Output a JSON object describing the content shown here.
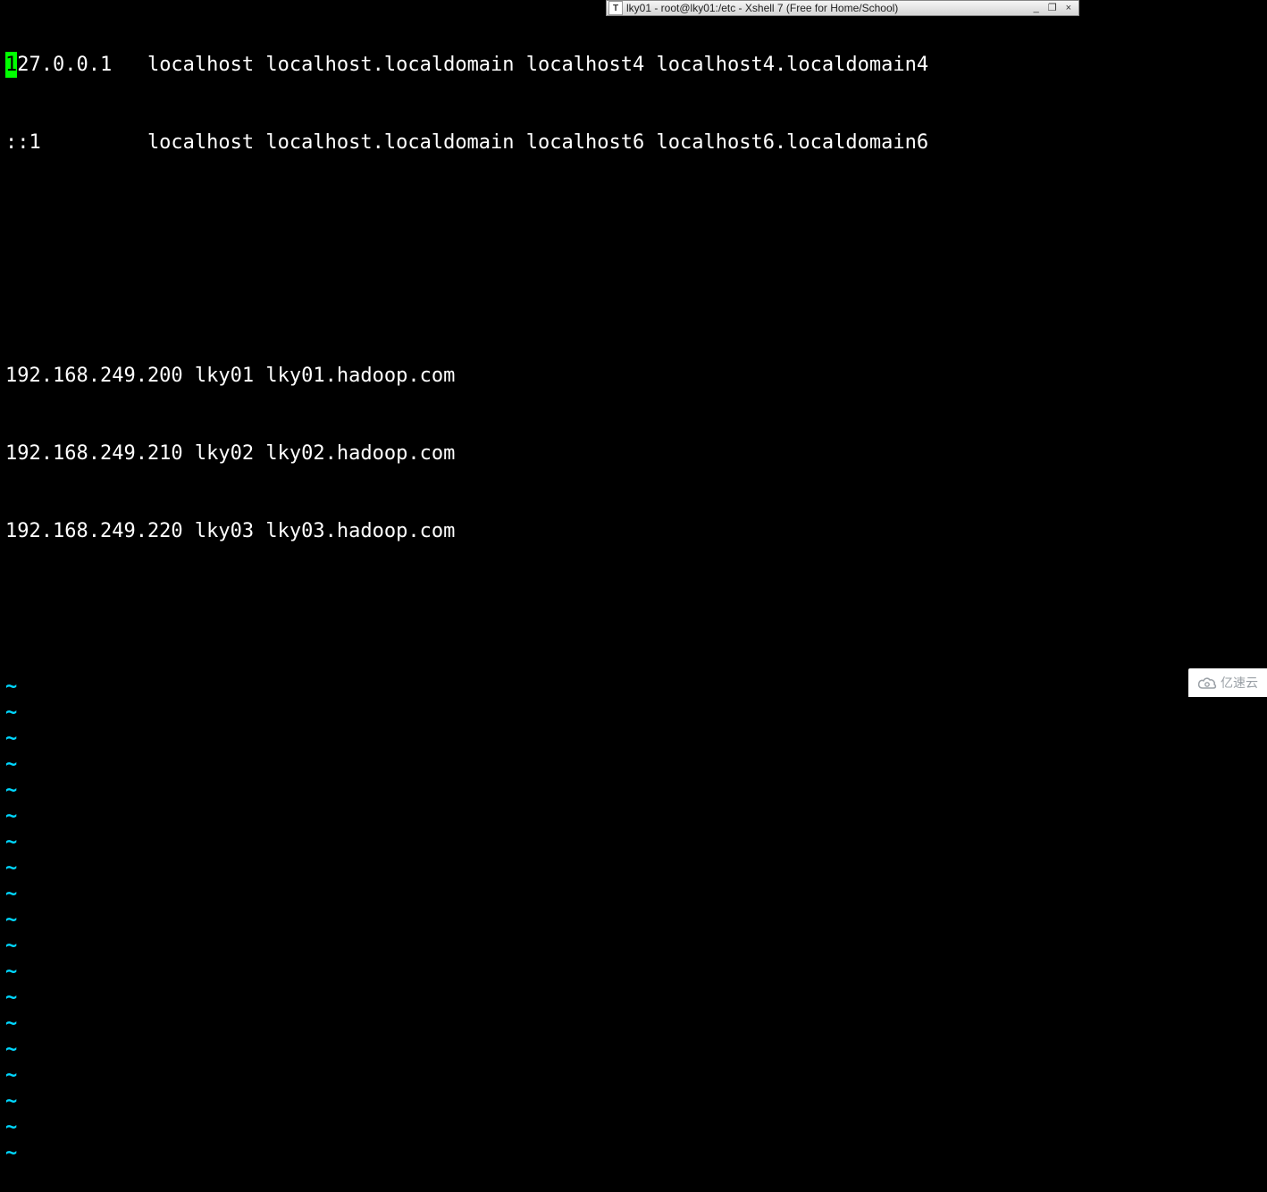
{
  "titlebar": {
    "icon_label": "T",
    "text": "lky01 - root@lky01:/etc - Xshell 7 (Free for Home/School)",
    "minimize": "_",
    "restore": "❐",
    "close": "×"
  },
  "editor": {
    "cursor_char": "1",
    "lines": [
      "27.0.0.1   localhost localhost.localdomain localhost4 localhost4.localdomain4",
      "::1         localhost localhost.localdomain localhost6 localhost6.localdomain6",
      "",
      "",
      "192.168.249.200 lky01 lky01.hadoop.com",
      "192.168.249.210 lky02 lky02.hadoop.com",
      "192.168.249.220 lky03 lky03.hadoop.com",
      ""
    ],
    "tilde": "~",
    "tilde_count": 19
  },
  "watermark": {
    "text": "亿速云"
  }
}
